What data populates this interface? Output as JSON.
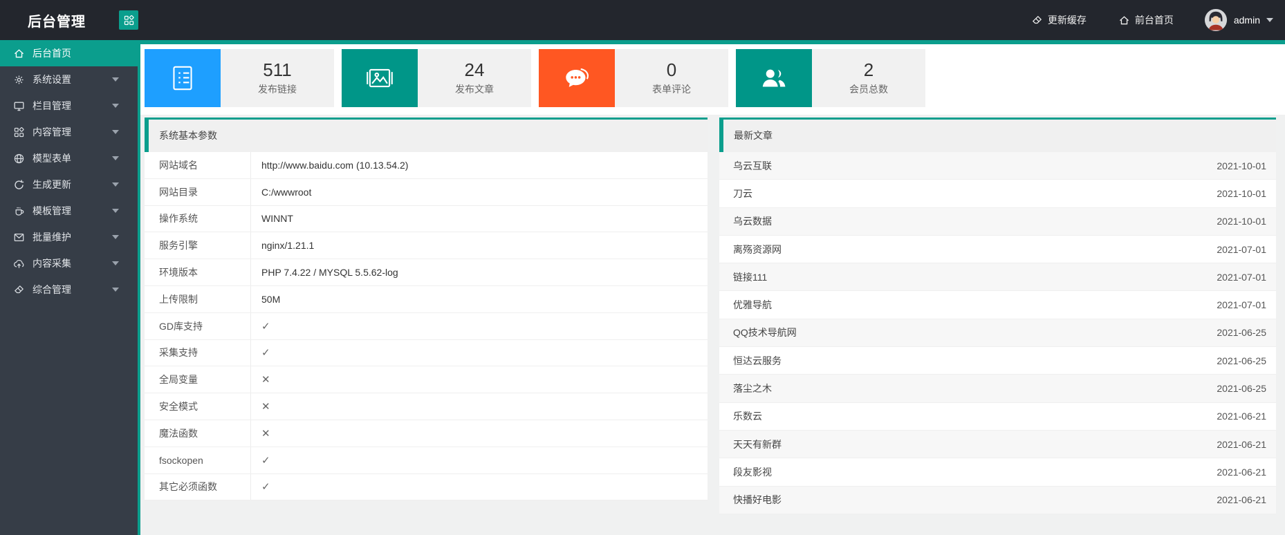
{
  "topbar": {
    "title": "后台管理",
    "app_button_icon": "grid-icon",
    "actions": [
      {
        "icon": "eraser-icon",
        "label": "更新缓存"
      },
      {
        "icon": "home-icon",
        "label": "前台首页"
      }
    ],
    "user": {
      "name": "admin",
      "avatar_icon": "avatar"
    }
  },
  "sidebar": {
    "items": [
      {
        "icon": "home-icon",
        "label": "后台首页",
        "active": true,
        "has_submenu": false
      },
      {
        "icon": "gear-icon",
        "label": "系统设置",
        "has_submenu": true
      },
      {
        "icon": "monitor-icon",
        "label": "栏目管理",
        "has_submenu": true
      },
      {
        "icon": "grid-icon",
        "label": "内容管理",
        "has_submenu": true
      },
      {
        "icon": "globe-icon",
        "label": "模型表单",
        "has_submenu": true
      },
      {
        "icon": "refresh-icon",
        "label": "生成更新",
        "has_submenu": true
      },
      {
        "icon": "cup-icon",
        "label": "模板管理",
        "has_submenu": true
      },
      {
        "icon": "mail-icon",
        "label": "批量维护",
        "has_submenu": true
      },
      {
        "icon": "cloud-upload-icon",
        "label": "内容采集",
        "has_submenu": true
      },
      {
        "icon": "eraser-icon",
        "label": "综合管理",
        "has_submenu": true
      }
    ]
  },
  "stats": [
    {
      "icon": "document-icon",
      "color": "#1e9fff",
      "value": "511",
      "label": "发布链接"
    },
    {
      "icon": "picture-icon",
      "color": "#009688",
      "value": "24",
      "label": "发布文章"
    },
    {
      "icon": "comment-icon",
      "color": "#ff5722",
      "value": "0",
      "label": "表单评论"
    },
    {
      "icon": "users-icon",
      "color": "#009688",
      "value": "2",
      "label": "会员总数"
    }
  ],
  "system_panel": {
    "title": "系统基本参数",
    "rows": [
      {
        "label": "网站域名",
        "value": "http://www.baidu.com (10.13.54.2)",
        "type": "text"
      },
      {
        "label": "网站目录",
        "value": "C:/wwwroot",
        "type": "text"
      },
      {
        "label": "操作系统",
        "value": "WINNT",
        "type": "text"
      },
      {
        "label": "服务引擎",
        "value": "nginx/1.21.1",
        "type": "text"
      },
      {
        "label": "环境版本",
        "value": "PHP 7.4.22 / MYSQL 5.5.62-log",
        "type": "text"
      },
      {
        "label": "上传限制",
        "value": "50M",
        "type": "text"
      },
      {
        "label": "GD库支持",
        "value": "✓",
        "type": "check"
      },
      {
        "label": "采集支持",
        "value": "✓",
        "type": "check"
      },
      {
        "label": "全局变量",
        "value": "✕",
        "type": "cross"
      },
      {
        "label": "安全模式",
        "value": "✕",
        "type": "cross"
      },
      {
        "label": "魔法函数",
        "value": "✕",
        "type": "cross"
      },
      {
        "label": "fsockopen",
        "value": "✓",
        "type": "check"
      },
      {
        "label": "其它必须函数",
        "value": "✓",
        "type": "check"
      }
    ]
  },
  "articles_panel": {
    "title": "最新文章",
    "items": [
      {
        "title": "乌云互联",
        "date": "2021-10-01"
      },
      {
        "title": "刀云",
        "date": "2021-10-01"
      },
      {
        "title": "乌云数据",
        "date": "2021-10-01"
      },
      {
        "title": "离殇资源网",
        "date": "2021-07-01"
      },
      {
        "title": "链接111",
        "date": "2021-07-01"
      },
      {
        "title": "优雅导航",
        "date": "2021-07-01"
      },
      {
        "title": "QQ技术导航网",
        "date": "2021-06-25"
      },
      {
        "title": "恒达云服务",
        "date": "2021-06-25"
      },
      {
        "title": "落尘之木",
        "date": "2021-06-25"
      },
      {
        "title": "乐数云",
        "date": "2021-06-21"
      },
      {
        "title": "天天有新群",
        "date": "2021-06-21"
      },
      {
        "title": "段友影视",
        "date": "2021-06-21"
      },
      {
        "title": "快播好电影",
        "date": "2021-06-21"
      }
    ]
  },
  "colors": {
    "accent": "#0b9e8d",
    "blue": "#1e9fff",
    "orange": "#ff5722",
    "teal": "#009688"
  }
}
